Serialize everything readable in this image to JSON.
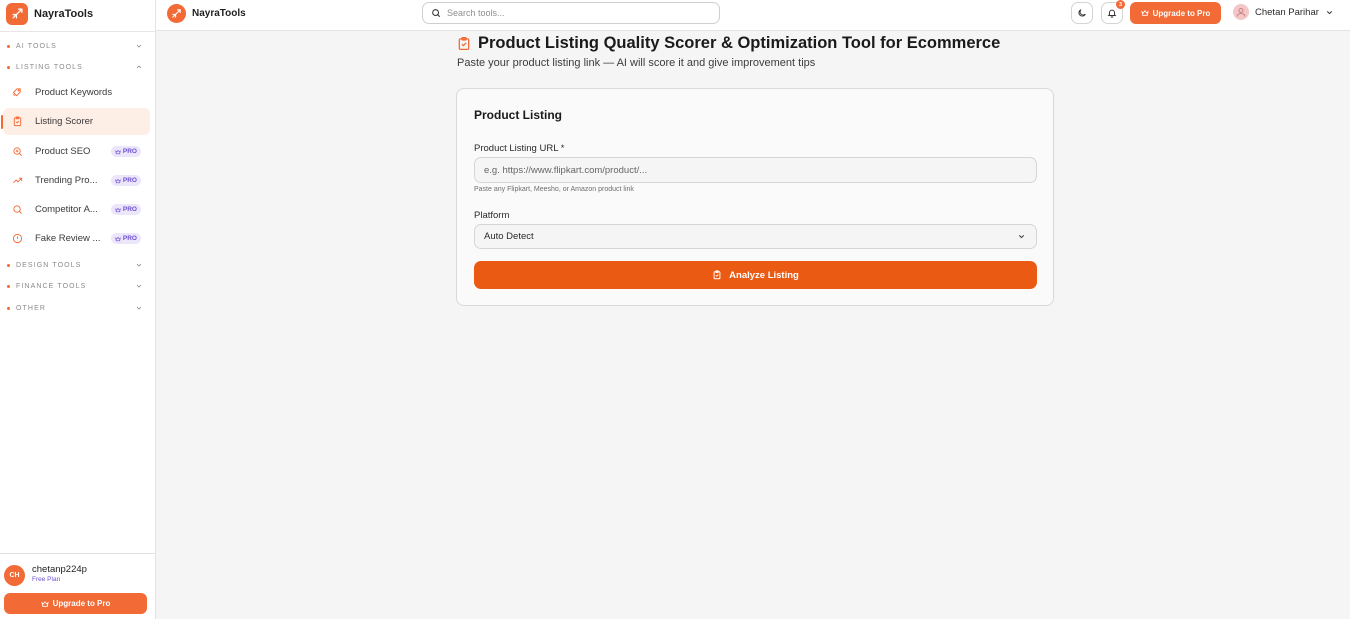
{
  "sidebar": {
    "brand": "NayraTools",
    "sections": {
      "ai_tools": "AI TOOLS",
      "listing_tools": "LISTING TOOLS",
      "design_tools": "DESIGN TOOLS",
      "finance_tools": "FINANCE TOOLS",
      "other": "OTHER"
    },
    "items": [
      {
        "label": "Product Keywords",
        "icon": "tags-icon",
        "pro": false,
        "active": false
      },
      {
        "label": "Listing Scorer",
        "icon": "clipboard-icon",
        "pro": false,
        "active": true
      },
      {
        "label": "Product SEO",
        "icon": "search-zoom-icon",
        "pro": true,
        "active": false
      },
      {
        "label": "Trending Pro...",
        "icon": "trending-up-icon",
        "pro": true,
        "active": false
      },
      {
        "label": "Competitor A...",
        "icon": "search-icon",
        "pro": true,
        "active": false
      },
      {
        "label": "Fake Review ...",
        "icon": "alert-circle-icon",
        "pro": true,
        "active": false
      }
    ],
    "pro_label": "PRO",
    "footer": {
      "initials": "CH",
      "username": "chetanp224p",
      "plan": "Free Plan",
      "upgrade_label": "Upgrade to Pro"
    }
  },
  "topbar": {
    "brand": "NayraTools",
    "search_placeholder": "Search tools...",
    "notification_count": "3",
    "upgrade_label": "Upgrade to Pro",
    "user_name": "Chetan Parihar"
  },
  "main": {
    "title": "Product Listing Quality Scorer & Optimization Tool for Ecommerce",
    "subtitle": "Paste your product listing link — AI will score it and give improvement tips",
    "card": {
      "title": "Product Listing",
      "url_label": "Product Listing URL *",
      "url_placeholder": "e.g. https://www.flipkart.com/product/...",
      "url_value": "",
      "url_hint": "Paste any Flipkart, Meesho, or Amazon product link",
      "platform_label": "Platform",
      "platform_value": "Auto Detect",
      "analyze_label": "Analyze Listing"
    }
  },
  "colors": {
    "accent": "#f26a35",
    "button": "#eb5a12",
    "pro_text": "#6d4fd1",
    "pro_bg": "#ece6fb"
  }
}
